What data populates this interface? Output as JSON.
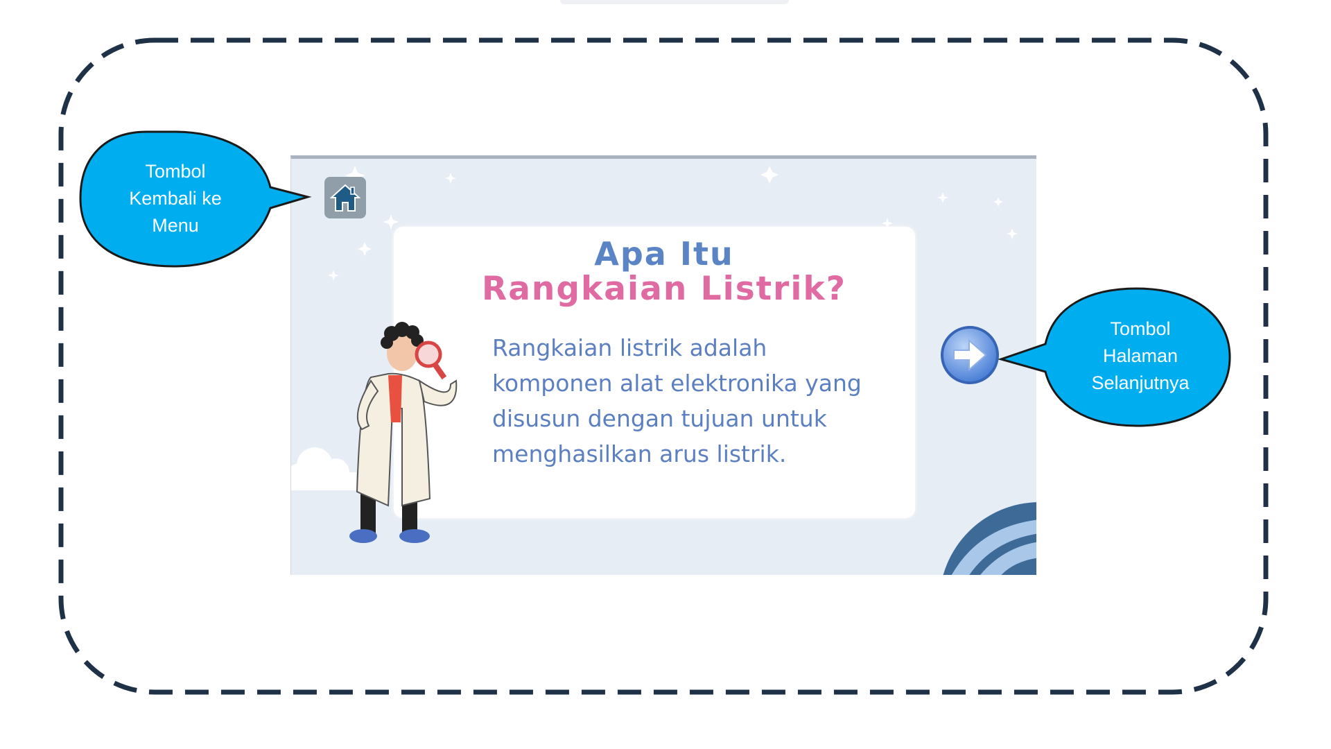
{
  "slide": {
    "title_line1": "Apa Itu",
    "title_line2": "Rangkaian Listrik?",
    "body_lines": [
      "Rangkaian listrik adalah",
      "komponen alat elektronika yang",
      "disusun dengan tujuan untuk",
      "menghasilkan arus listrik."
    ]
  },
  "callouts": {
    "home": {
      "lines": [
        "Tombol",
        "Kembali ke",
        "Menu"
      ]
    },
    "next": {
      "lines": [
        "Tombol",
        "Halaman",
        "Selanjutnya"
      ]
    }
  },
  "icons": {
    "home_button": "home-icon",
    "next_button": "arrow-right-icon"
  },
  "colors": {
    "callout_fill": "#00aeef",
    "frame_dash": "#1f3147",
    "title_blue": "#5b84c4",
    "title_pink": "#e06aa2",
    "slide_bg": "#e6edf5"
  }
}
